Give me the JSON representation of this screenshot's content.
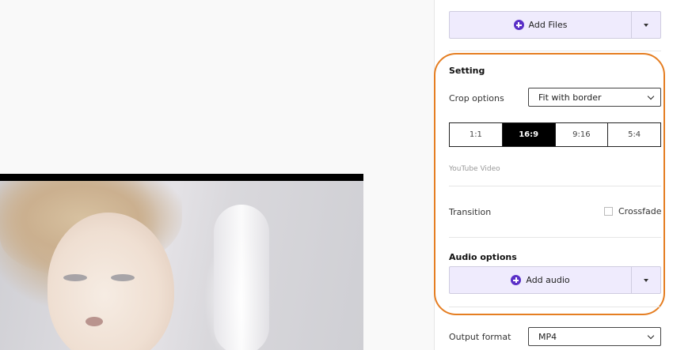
{
  "files": {
    "add_label": "Add Files"
  },
  "setting": {
    "heading": "Setting",
    "crop_label": "Crop options",
    "crop_value": "Fit with border",
    "ratios": [
      "1:1",
      "16:9",
      "9:16",
      "5:4"
    ],
    "active_ratio": "16:9",
    "ratio_hint": "YouTube Video",
    "transition_label": "Transition",
    "crossfade_label": "Crossfade",
    "crossfade_checked": false
  },
  "audio": {
    "heading": "Audio options",
    "add_label": "Add audio"
  },
  "output": {
    "label": "Output format",
    "value": "MP4"
  },
  "colors": {
    "accent": "#5a2fc7",
    "highlight": "#e57e22",
    "button_bg": "#efebfd"
  }
}
